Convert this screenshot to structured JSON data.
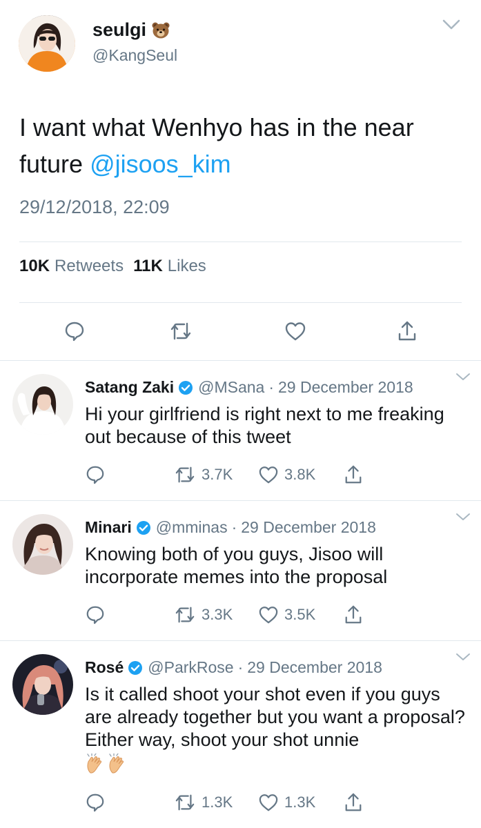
{
  "main_tweet": {
    "author_name": "seulgi",
    "author_emoji": "bear-face-emoji",
    "handle": "@KangSeul",
    "text_before": "I want what Wenhyo has in the near future ",
    "mention": "@jisoos_kim",
    "timestamp": "29/12/2018, 22:09",
    "retweet_count": "10K",
    "retweet_label": "Retweets",
    "like_count": "11K",
    "like_label": "Likes",
    "actions": [
      "reply-icon",
      "retweet-icon",
      "heart-icon",
      "share-icon"
    ]
  },
  "replies": [
    {
      "name": "Satang Zaki",
      "verified": true,
      "handle": "@MSana",
      "dot": "·",
      "date": "29 December 2018",
      "text": "Hi your girlfriend is right next to me freaking out because of this tweet",
      "retweets": "3.7K",
      "likes": "3.8K"
    },
    {
      "name": "Minari",
      "verified": true,
      "handle": "@mminas",
      "dot": "·",
      "date": "29 December 2018",
      "text": "Knowing both of you guys, Jisoo will incorporate memes into the proposal",
      "retweets": "3.3K",
      "likes": "3.5K"
    },
    {
      "name": "Rosé",
      "verified": true,
      "handle": "@ParkRose",
      "dot": "·",
      "date": "29 December 2018",
      "text": "Is it called shoot your shot even if you guys are already together but you want a proposal? Either way, shoot your shot unnie",
      "emoji": [
        "clapping-hands-emoji",
        "clapping-hands-emoji"
      ],
      "retweets": "1.3K",
      "likes": "1.3K"
    }
  ],
  "colors": {
    "text": "#14171a",
    "secondary": "#657786",
    "link": "#1da1f2",
    "divider": "#e1e8ed"
  }
}
